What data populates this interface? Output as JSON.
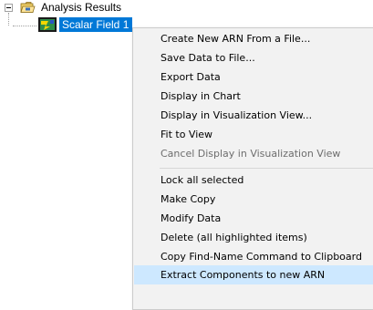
{
  "tree": {
    "root": {
      "label": "Analysis Results",
      "expanded": true,
      "icon": "folder-icon"
    },
    "selected_child": {
      "label": "Scalar Field 1",
      "icon": "scalar-field-icon",
      "selected": true
    }
  },
  "colors": {
    "selection_bg": "#0078d7",
    "menu_bg": "#f2f2f2",
    "menu_highlight": "#cde8ff",
    "disabled_text": "#6d6d6d"
  },
  "context_menu": {
    "group1": [
      {
        "label": "Create New ARN From a File...",
        "enabled": true
      },
      {
        "label": "Save Data to File...",
        "enabled": true
      },
      {
        "label": "Export Data",
        "enabled": true
      },
      {
        "label": "Display in Chart",
        "enabled": true
      },
      {
        "label": "Display in Visualization View...",
        "enabled": true
      },
      {
        "label": "Fit to View",
        "enabled": true
      },
      {
        "label": "Cancel Display in Visualization View",
        "enabled": false
      }
    ],
    "group2": [
      {
        "label": "Lock all selected",
        "enabled": true
      },
      {
        "label": "Make Copy",
        "enabled": true
      },
      {
        "label": "Modify Data",
        "enabled": true
      },
      {
        "label": "Delete (all highlighted items)",
        "enabled": true
      },
      {
        "label": "Copy Find-Name Command to Clipboard",
        "enabled": true
      },
      {
        "label": "Extract Components to new ARN",
        "enabled": true,
        "highlighted": true
      }
    ]
  }
}
